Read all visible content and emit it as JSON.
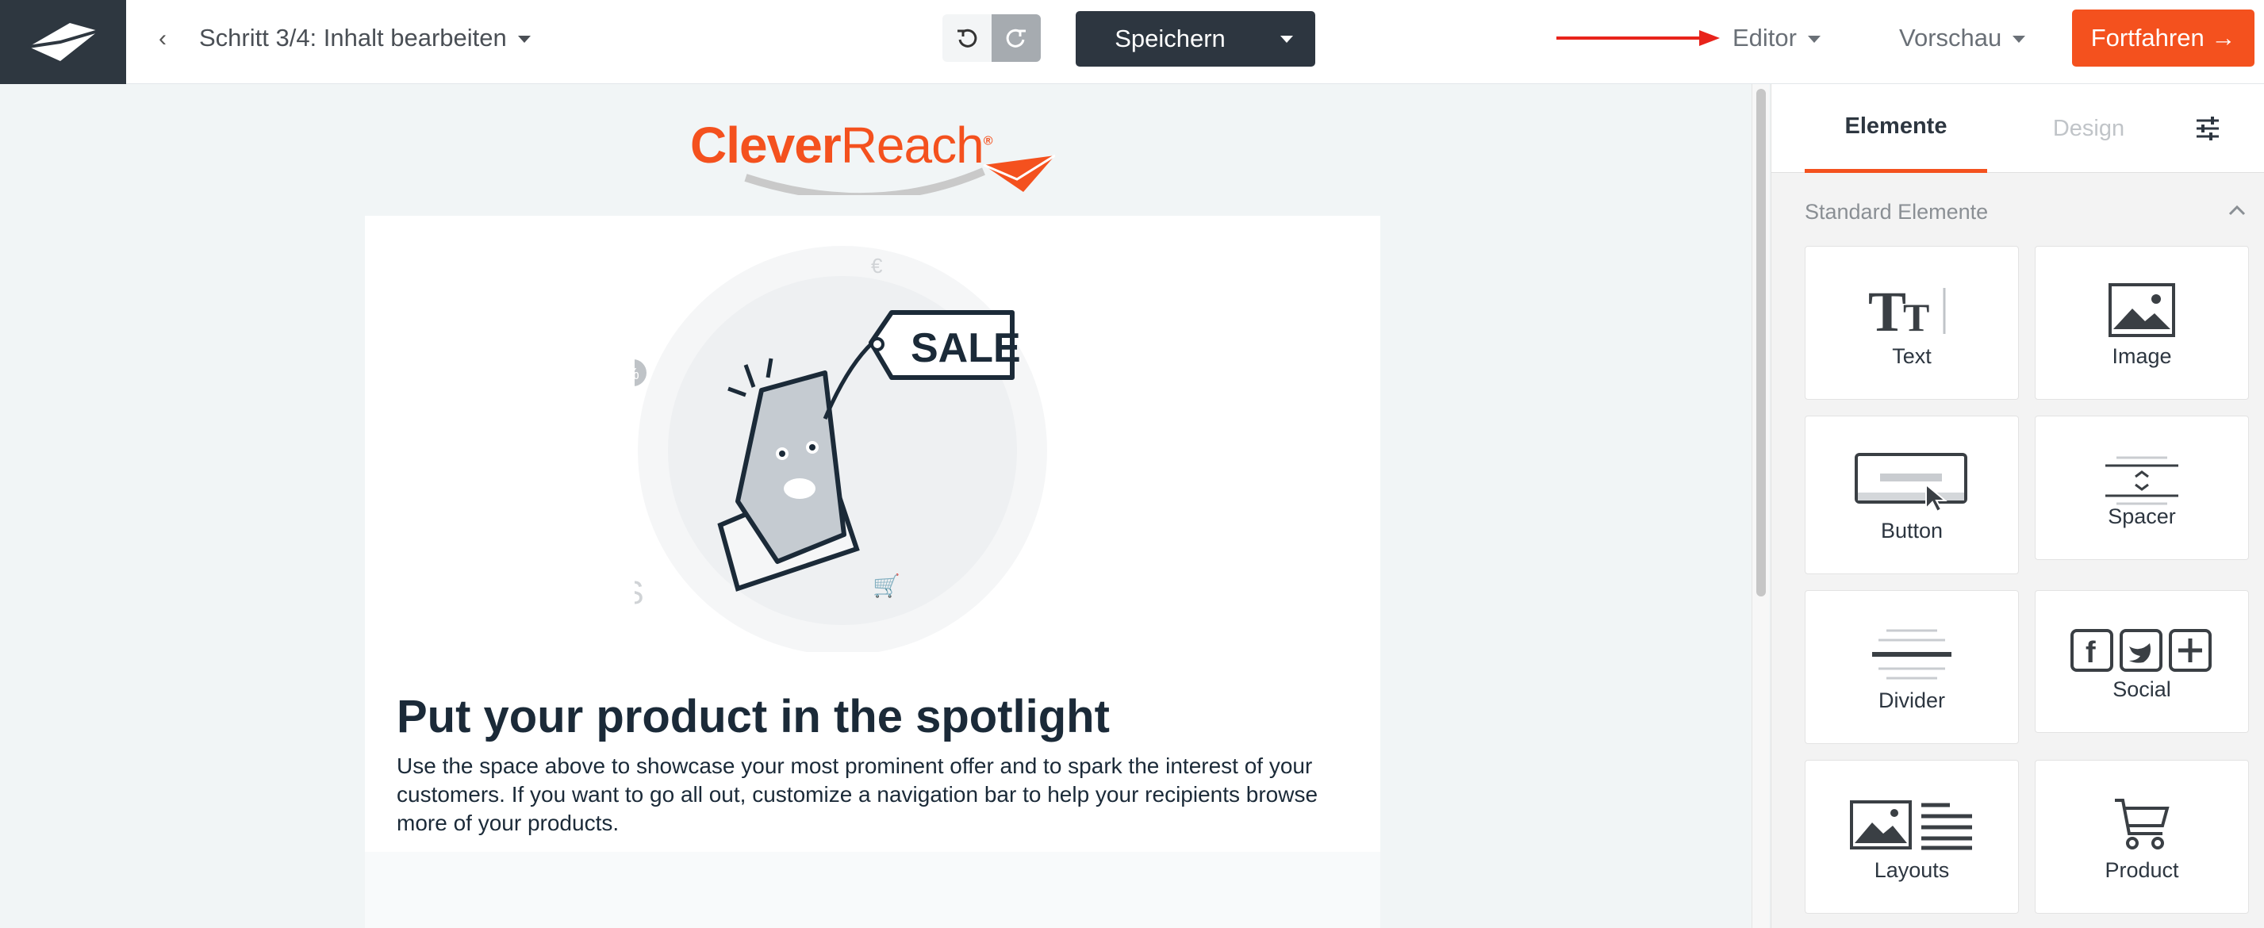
{
  "header": {
    "step_label": "Schritt 3/4: Inhalt bearbeiten",
    "save_label": "Speichern",
    "editor_label": "Editor",
    "preview_label": "Vorschau",
    "proceed_label": "Fortfahren →"
  },
  "brand": {
    "part1": "Clever",
    "part2": "Reach",
    "registered": "®"
  },
  "email": {
    "sale_tag": "SALE",
    "headline": "Put your product in the spotlight",
    "body": "Use the space above to showcase your most prominent offer and to spark the interest of your customers. If you want to go all out, customize a navigation bar to help your recipients browse more of your products."
  },
  "panel": {
    "tabs": [
      {
        "label": "Elemente",
        "active": true
      },
      {
        "label": "Design",
        "active": false
      }
    ],
    "section_title": "Standard Elemente",
    "elements": [
      {
        "label": "Text",
        "icon": "text-icon"
      },
      {
        "label": "Image",
        "icon": "image-icon"
      },
      {
        "label": "Button",
        "icon": "button-icon"
      },
      {
        "label": "Spacer",
        "icon": "spacer-icon"
      },
      {
        "label": "Divider",
        "icon": "divider-icon"
      },
      {
        "label": "Social",
        "icon": "social-icon"
      },
      {
        "label": "Layouts",
        "icon": "layouts-icon"
      },
      {
        "label": "Product",
        "icon": "cart-icon"
      }
    ]
  },
  "colors": {
    "accent": "#f4511e",
    "dark": "#2d3640",
    "arrow": "#e8231b"
  }
}
